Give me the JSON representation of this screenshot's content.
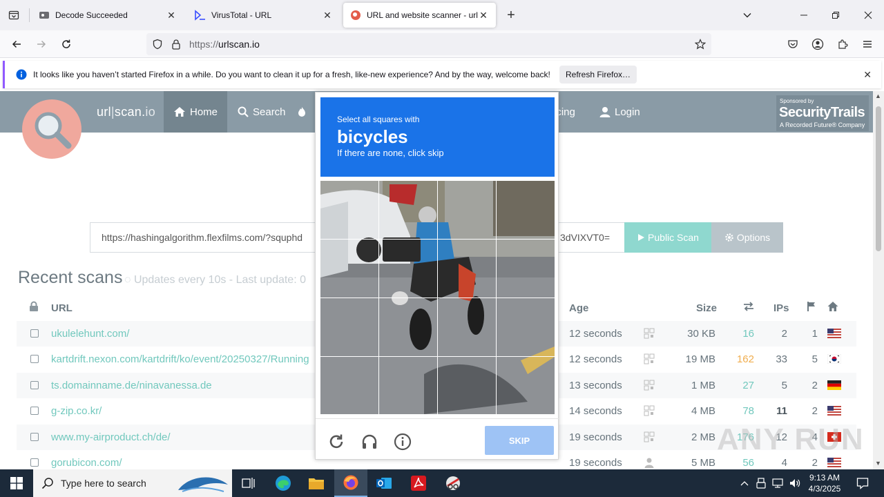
{
  "browser": {
    "tabs": [
      {
        "title": "Decode Succeeded",
        "active": false
      },
      {
        "title": "VirusTotal - URL",
        "active": false
      },
      {
        "title": "URL and website scanner - urlscan.io",
        "active": true
      }
    ],
    "url_prefix": "https://",
    "url_host": "urlscan.io",
    "notification": {
      "message": "It looks like you haven’t started Firefox in a while. Do you want to clean it up for a fresh, like-new experience? And by the way, welcome back!",
      "button": "Refresh Firefox…"
    }
  },
  "site": {
    "brand_main": "url",
    "brand_sep": "|",
    "brand_rest": "scan.",
    "brand_io": "io",
    "menu": {
      "home": "Home",
      "search": "Search",
      "pricing": "icing",
      "login": "Login"
    },
    "sponsor": {
      "line1": "Sponsored by",
      "line2": "SecurityTrails",
      "line3": "A Recorded Future® Company"
    },
    "scan": {
      "input_left": "https://hashingalgorithm.flexfilms.com/?squphd",
      "input_right": "3dVIXVT0=",
      "public_scan": "Public Scan",
      "options": "Options"
    },
    "recent": {
      "title": "Recent scans",
      "subtitle": "Updates every 10s - Last update: 0"
    },
    "table": {
      "headers": {
        "url": "URL",
        "age": "Age",
        "size": "Size",
        "ips": "IPs"
      },
      "rows": [
        {
          "url": "ukulelehunt.com/",
          "age": "12 seconds",
          "size": "30 KB",
          "requests": "16",
          "ips": "2",
          "count": "1",
          "flag": "us"
        },
        {
          "url": "kartdrift.nexon.com/kartdrift/ko/event/20250327/Running",
          "age": "12 seconds",
          "size": "19 MB",
          "requests": "162",
          "ips": "33",
          "count": "5",
          "flag": "kr"
        },
        {
          "url": "ts.domainname.de/ninavanessa.de",
          "age": "13 seconds",
          "size": "1 MB",
          "requests": "27",
          "ips": "5",
          "count": "2",
          "flag": "de"
        },
        {
          "url": "g-zip.co.kr/",
          "age": "14 seconds",
          "size": "4 MB",
          "requests": "78",
          "ips": "11",
          "count": "2",
          "flag": "us"
        },
        {
          "url": "www.my-airproduct.ch/de/",
          "age": "19 seconds",
          "size": "2 MB",
          "requests": "176",
          "ips": "12",
          "count": "4",
          "flag": "ch"
        },
        {
          "url": "gorubicon.com/",
          "age": "19 seconds",
          "size": "5 MB",
          "requests": "56",
          "ips": "4",
          "count": "2",
          "flag": "us"
        }
      ]
    }
  },
  "captcha": {
    "line1": "Select all squares with",
    "keyword": "bicycles",
    "line3": "If there are none, click skip",
    "skip": "SKIP"
  },
  "watermark": "ANY RUN",
  "taskbar": {
    "search_placeholder": "Type here to search",
    "time": "9:13 AM",
    "date": "4/3/2025"
  },
  "colors": {
    "header": "#8a9ba6",
    "accent_teal": "#71c8bd",
    "captcha_blue": "#1a73e8",
    "warn": "#f0ad4e"
  }
}
